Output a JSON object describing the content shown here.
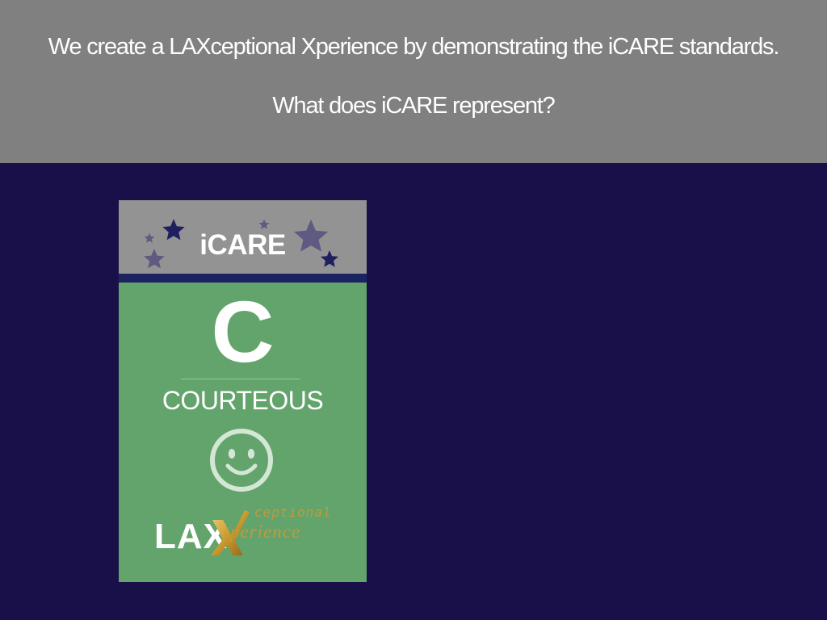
{
  "banner": {
    "line1": "We create a LAXceptional Xperience by  demonstrating the iCARE standards.",
    "line2": "What does iCARE represent?"
  },
  "card": {
    "header_title": "iCARE",
    "letter": "C",
    "word": "COURTEOUS",
    "icon": "smiley-face-icon",
    "logo": {
      "lax": "LAX",
      "x": "X",
      "ceptional": "ceptional",
      "perience": "perience"
    }
  },
  "colors": {
    "banner_bg": "#808080",
    "page_bg": "#1a1049",
    "card_green": "#63a46c",
    "card_header_gray": "#939393",
    "stripe_navy": "#1b2460",
    "gold": "#c4993b"
  }
}
